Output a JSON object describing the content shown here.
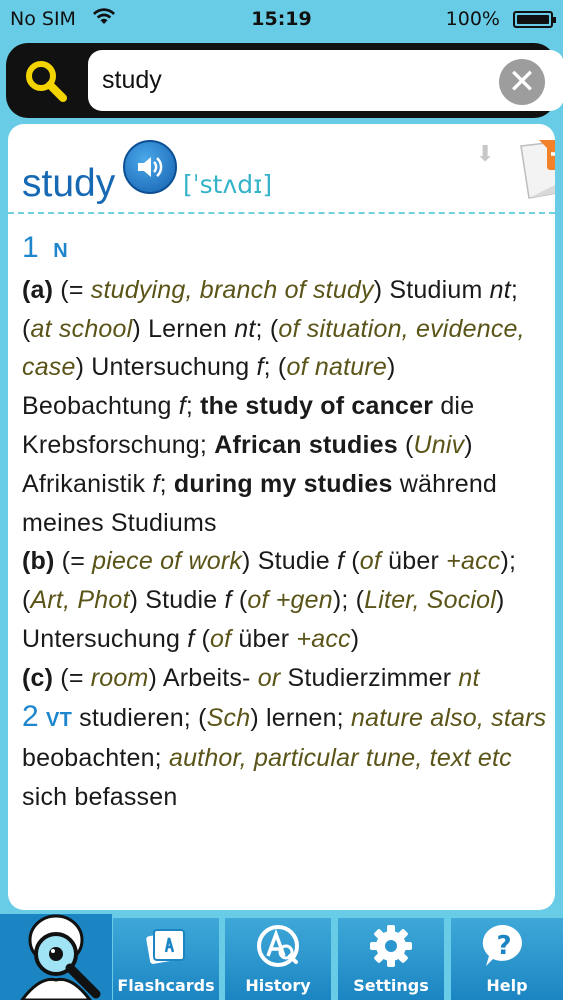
{
  "status_bar": {
    "carrier": "No SIM",
    "time": "15:19",
    "battery": "100%"
  },
  "search": {
    "query": "study",
    "icon": "search-icon",
    "clear_icon": "clear-icon"
  },
  "entry": {
    "headword": "study",
    "pronunciation": "[ˈstʌdɪ]",
    "sense1": {
      "number": "1",
      "pos": "N",
      "a_label": "(a)",
      "a_gloss_open": " (= ",
      "a_gloss": "studying, branch of study",
      "a_text1": ") Studium ",
      "a_g1": "nt",
      "a_text2": "; (",
      "a_ctx1": "at school",
      "a_text3": ") Lernen ",
      "a_g2": "nt",
      "a_text4": "; (",
      "a_ctx2": "of situation, evidence, case",
      "a_text5": ") Untersuchung ",
      "a_g3": "f",
      "a_text6": "; (",
      "a_ctx3": "of nature",
      "a_text7": ") Beobachtung ",
      "a_g4": "f",
      "a_text8": "; ",
      "a_ex1": "the study of cancer",
      "a_text9": " die Krebsforschung; ",
      "a_ex2": "African studies",
      "a_text10": " (",
      "a_ctx4": "Univ",
      "a_text11": ") Afrikanistik ",
      "a_g5": "f",
      "a_text12": "; ",
      "a_ex3": "during my studies",
      "a_text13": " während meines Studiums",
      "b_label": "(b)",
      "b_text1": " (= ",
      "b_gloss": "piece of work",
      "b_text2": ") Studie ",
      "b_g1": "f",
      "b_text3": " (",
      "b_ctx1": "of",
      "b_text4": " über ",
      "b_ctx2": "+acc",
      "b_text5": "); (",
      "b_ctx3": "Art, Phot",
      "b_text6": ") Studie ",
      "b_g2": "f",
      "b_text7": " (",
      "b_ctx4": "of +gen",
      "b_text8": "); (",
      "b_ctx5": "Liter, Sociol",
      "b_text9": ") Untersuchung ",
      "b_g3": "f",
      "b_text10": " (",
      "b_ctx6": "of",
      "b_text11": " über ",
      "b_ctx7": "+acc",
      "b_text12": ")",
      "c_label": "(c)",
      "c_text1": " (= ",
      "c_gloss": "room",
      "c_text2": ") Arbeits- ",
      "c_or": "or",
      "c_text3": " Studierzimmer ",
      "c_g1": "nt"
    },
    "sense2": {
      "number": "2",
      "pos": "VT",
      "text1": " studieren; (",
      "ctx1": "Sch",
      "text2": ") lernen; ",
      "ctx2": "nature also, stars",
      "text3": " beobachten; ",
      "ctx3": "author, particular tune, text etc",
      "text4": " sich befassen"
    }
  },
  "tabs": [
    {
      "label": "Flashcards",
      "icon": "flashcards-icon"
    },
    {
      "label": "History",
      "icon": "history-icon"
    },
    {
      "label": "Settings",
      "icon": "gear-icon"
    },
    {
      "label": "Help",
      "icon": "help-icon"
    }
  ],
  "colors": {
    "background": "#69cce6",
    "headword": "#1769b4",
    "sense_number": "#1e86cd",
    "context_italic": "#5a5418",
    "tab": "#2996cf"
  }
}
